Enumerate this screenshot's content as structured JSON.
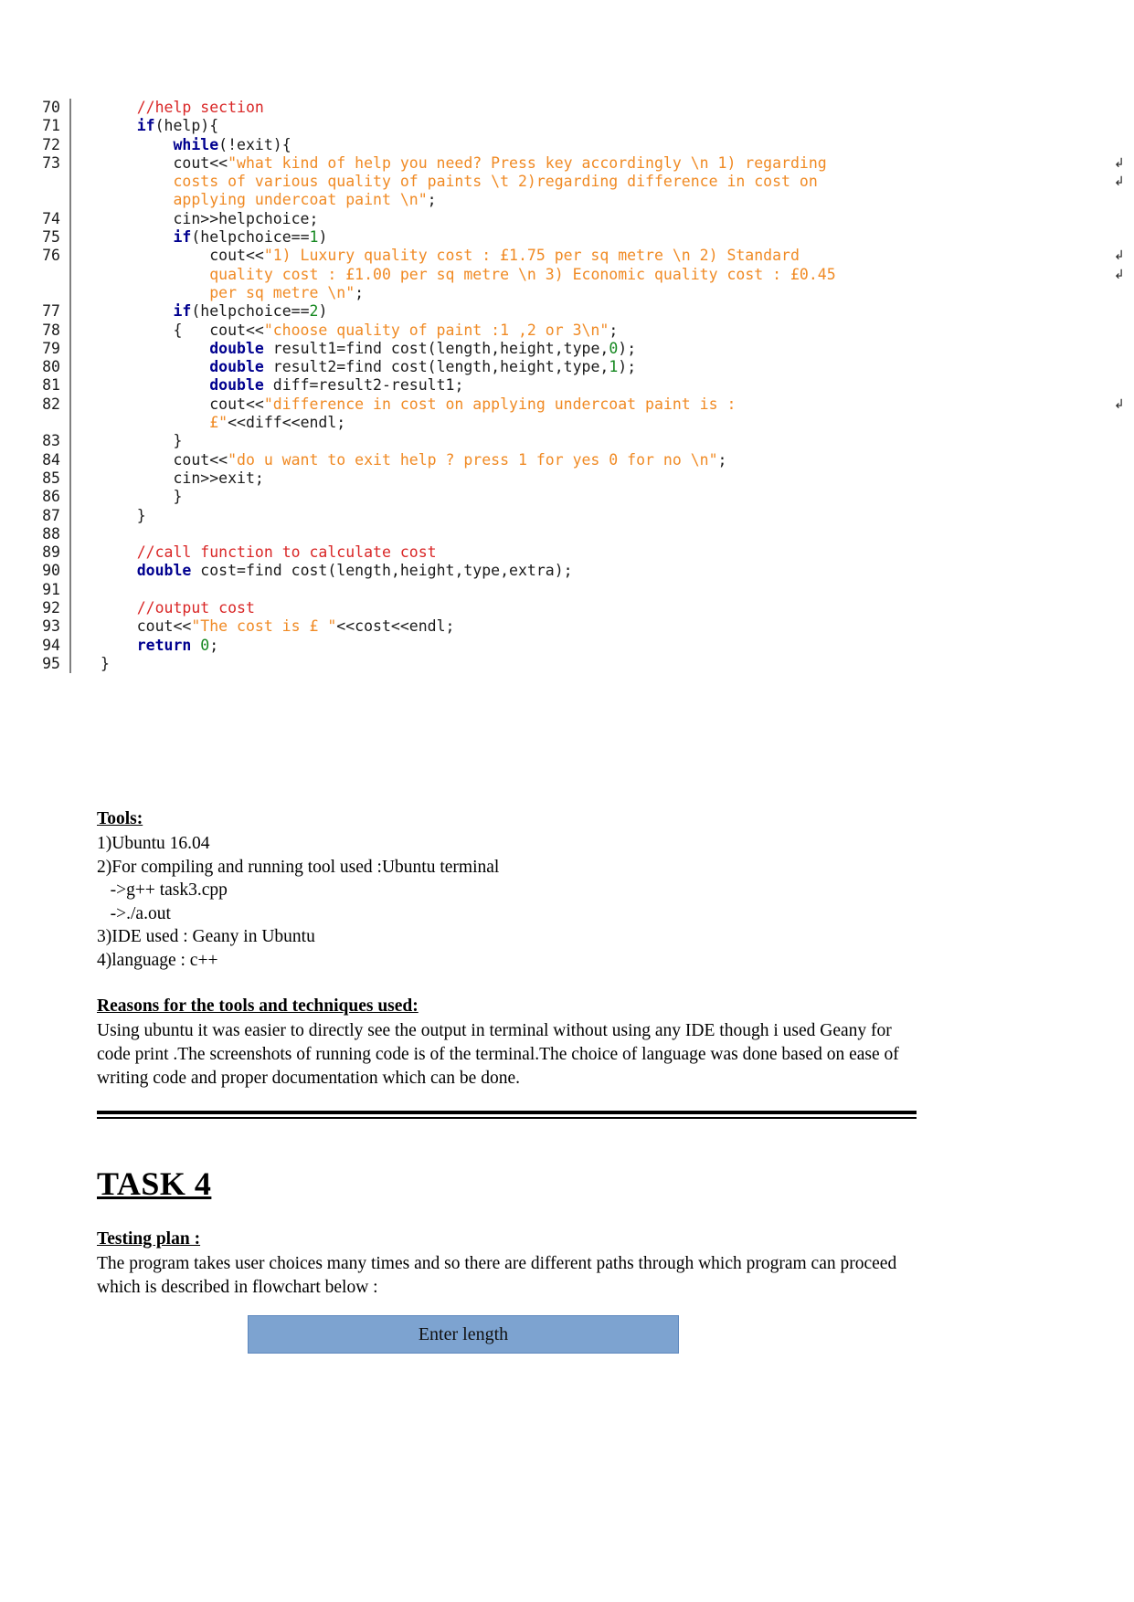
{
  "document": {
    "code_listing": {
      "language": "c++",
      "first_line": 70,
      "last_line": 95,
      "rows": [
        {
          "num": "70",
          "wrap": "",
          "tokens": [
            {
              "t": "    ",
              "c": "plain"
            },
            {
              "t": "//help section",
              "c": "cmt"
            }
          ]
        },
        {
          "num": "71",
          "wrap": "",
          "tokens": [
            {
              "t": "    ",
              "c": "plain"
            },
            {
              "t": "if",
              "c": "kw"
            },
            {
              "t": "(help){",
              "c": "plain"
            }
          ]
        },
        {
          "num": "72",
          "wrap": "",
          "tokens": [
            {
              "t": "        ",
              "c": "plain"
            },
            {
              "t": "while",
              "c": "kw"
            },
            {
              "t": "(!exit){",
              "c": "plain"
            }
          ]
        },
        {
          "num": "73",
          "wrap": "↲",
          "tokens": [
            {
              "t": "        cout<<",
              "c": "plain"
            },
            {
              "t": "\"what kind of help you need? Press key accordingly \\n 1) regarding",
              "c": "str"
            }
          ]
        },
        {
          "num": "",
          "wrap": "↲",
          "tokens": [
            {
              "t": "        ",
              "c": "plain"
            },
            {
              "t": "costs of various quality of paints \\t 2)regarding difference in cost on",
              "c": "str"
            }
          ]
        },
        {
          "num": "",
          "wrap": "",
          "tokens": [
            {
              "t": "        ",
              "c": "plain"
            },
            {
              "t": "applying undercoat paint \\n\"",
              "c": "str"
            },
            {
              "t": ";",
              "c": "plain"
            }
          ]
        },
        {
          "num": "74",
          "wrap": "",
          "tokens": [
            {
              "t": "        cin>>helpchoice;",
              "c": "plain"
            }
          ]
        },
        {
          "num": "75",
          "wrap": "",
          "tokens": [
            {
              "t": "        ",
              "c": "plain"
            },
            {
              "t": "if",
              "c": "kw"
            },
            {
              "t": "(helpchoice==",
              "c": "plain"
            },
            {
              "t": "1",
              "c": "num"
            },
            {
              "t": ")",
              "c": "plain"
            }
          ]
        },
        {
          "num": "76",
          "wrap": "↲",
          "tokens": [
            {
              "t": "            cout<<",
              "c": "plain"
            },
            {
              "t": "\"1) Luxury quality cost : £1.75 per sq metre \\n 2) Standard",
              "c": "str"
            }
          ]
        },
        {
          "num": "",
          "wrap": "↲",
          "tokens": [
            {
              "t": "            ",
              "c": "plain"
            },
            {
              "t": "quality cost : £1.00 per sq metre \\n 3) Economic quality cost : £0.45",
              "c": "str"
            }
          ]
        },
        {
          "num": "",
          "wrap": "",
          "tokens": [
            {
              "t": "            ",
              "c": "plain"
            },
            {
              "t": "per sq metre \\n\"",
              "c": "str"
            },
            {
              "t": ";",
              "c": "plain"
            }
          ]
        },
        {
          "num": "77",
          "wrap": "",
          "tokens": [
            {
              "t": "        ",
              "c": "plain"
            },
            {
              "t": "if",
              "c": "kw"
            },
            {
              "t": "(helpchoice==",
              "c": "plain"
            },
            {
              "t": "2",
              "c": "num"
            },
            {
              "t": ")",
              "c": "plain"
            }
          ]
        },
        {
          "num": "78",
          "wrap": "",
          "tokens": [
            {
              "t": "        {   cout<<",
              "c": "plain"
            },
            {
              "t": "\"choose quality of paint :1 ,2 or 3\\n\"",
              "c": "str"
            },
            {
              "t": ";",
              "c": "plain"
            }
          ]
        },
        {
          "num": "79",
          "wrap": "",
          "tokens": [
            {
              "t": "            ",
              "c": "plain"
            },
            {
              "t": "double",
              "c": "kw"
            },
            {
              "t": " result1=find cost(length,height,type,",
              "c": "plain"
            },
            {
              "t": "0",
              "c": "num"
            },
            {
              "t": ");",
              "c": "plain"
            }
          ]
        },
        {
          "num": "80",
          "wrap": "",
          "tokens": [
            {
              "t": "            ",
              "c": "plain"
            },
            {
              "t": "double",
              "c": "kw"
            },
            {
              "t": " result2=find cost(length,height,type,",
              "c": "plain"
            },
            {
              "t": "1",
              "c": "num"
            },
            {
              "t": ");",
              "c": "plain"
            }
          ]
        },
        {
          "num": "81",
          "wrap": "",
          "tokens": [
            {
              "t": "            ",
              "c": "plain"
            },
            {
              "t": "double",
              "c": "kw"
            },
            {
              "t": " diff=result2-result1;",
              "c": "plain"
            }
          ]
        },
        {
          "num": "82",
          "wrap": "↲",
          "tokens": [
            {
              "t": "            cout<<",
              "c": "plain"
            },
            {
              "t": "\"difference in cost on applying undercoat paint is :",
              "c": "str"
            }
          ]
        },
        {
          "num": "",
          "wrap": "",
          "tokens": [
            {
              "t": "            ",
              "c": "plain"
            },
            {
              "t": "£\"",
              "c": "str"
            },
            {
              "t": "<<diff<<endl;",
              "c": "plain"
            }
          ]
        },
        {
          "num": "83",
          "wrap": "",
          "tokens": [
            {
              "t": "        }",
              "c": "plain"
            }
          ]
        },
        {
          "num": "84",
          "wrap": "",
          "tokens": [
            {
              "t": "        cout<<",
              "c": "plain"
            },
            {
              "t": "\"do u want to exit help ? press 1 for yes 0 for no \\n\"",
              "c": "str"
            },
            {
              "t": ";",
              "c": "plain"
            }
          ]
        },
        {
          "num": "85",
          "wrap": "",
          "tokens": [
            {
              "t": "        cin>>exit;",
              "c": "plain"
            }
          ]
        },
        {
          "num": "86",
          "wrap": "",
          "tokens": [
            {
              "t": "        }",
              "c": "plain"
            }
          ]
        },
        {
          "num": "87",
          "wrap": "",
          "tokens": [
            {
              "t": "    }",
              "c": "plain"
            }
          ]
        },
        {
          "num": "88",
          "wrap": "",
          "tokens": [
            {
              "t": "",
              "c": "plain"
            }
          ]
        },
        {
          "num": "89",
          "wrap": "",
          "tokens": [
            {
              "t": "    ",
              "c": "plain"
            },
            {
              "t": "//call function to calculate cost",
              "c": "cmt"
            }
          ]
        },
        {
          "num": "90",
          "wrap": "",
          "tokens": [
            {
              "t": "    ",
              "c": "plain"
            },
            {
              "t": "double",
              "c": "kw"
            },
            {
              "t": " cost=find cost(length,height,type,extra);",
              "c": "plain"
            }
          ]
        },
        {
          "num": "91",
          "wrap": "",
          "tokens": [
            {
              "t": "",
              "c": "plain"
            }
          ]
        },
        {
          "num": "92",
          "wrap": "",
          "tokens": [
            {
              "t": "    ",
              "c": "plain"
            },
            {
              "t": "//output cost",
              "c": "cmt"
            }
          ]
        },
        {
          "num": "93",
          "wrap": "",
          "tokens": [
            {
              "t": "    cout<<",
              "c": "plain"
            },
            {
              "t": "\"The cost is £ \"",
              "c": "str"
            },
            {
              "t": "<<cost<<endl;",
              "c": "plain"
            }
          ]
        },
        {
          "num": "94",
          "wrap": "",
          "tokens": [
            {
              "t": "    ",
              "c": "plain"
            },
            {
              "t": "return",
              "c": "kw"
            },
            {
              "t": " ",
              "c": "plain"
            },
            {
              "t": "0",
              "c": "num"
            },
            {
              "t": ";",
              "c": "plain"
            }
          ]
        },
        {
          "num": "95",
          "wrap": "",
          "tokens": [
            {
              "t": "}",
              "c": "plain"
            }
          ]
        }
      ]
    },
    "tools_section": {
      "heading": "Tools: ",
      "items": [
        "1)Ubuntu 16.04",
        "2)For compiling and running tool used :Ubuntu terminal",
        "   ->g++ task3.cpp",
        "   ->./a.out",
        "3)IDE used : Geany in Ubuntu",
        "4)language : c++"
      ]
    },
    "reasons_section": {
      "heading": "Reasons for the tools and techniques used:",
      "paragraph": "Using ubuntu it was easier to directly see the output in terminal without using any IDE though i used Geany for code print .The screenshots of running code is of the terminal.The choice of language was done based on ease of writing code and proper documentation which can be done."
    },
    "task_section": {
      "title": "TASK 4",
      "testing_plan_heading": "Testing plan :",
      "testing_plan_paragraph": "The program takes user choices many times and so there are different paths through which program can proceed which is described in flowchart below :"
    },
    "flowchart": {
      "first_node_label": "Enter length",
      "node_fill": "#7DA3D0",
      "node_border": "#5E88BE"
    },
    "colors": {
      "keyword": "#00008f",
      "string": "#f08a24",
      "comment": "#d92626",
      "number": "#14871f",
      "text": "#1a1a1a",
      "gutter_rule": "#808080"
    }
  }
}
